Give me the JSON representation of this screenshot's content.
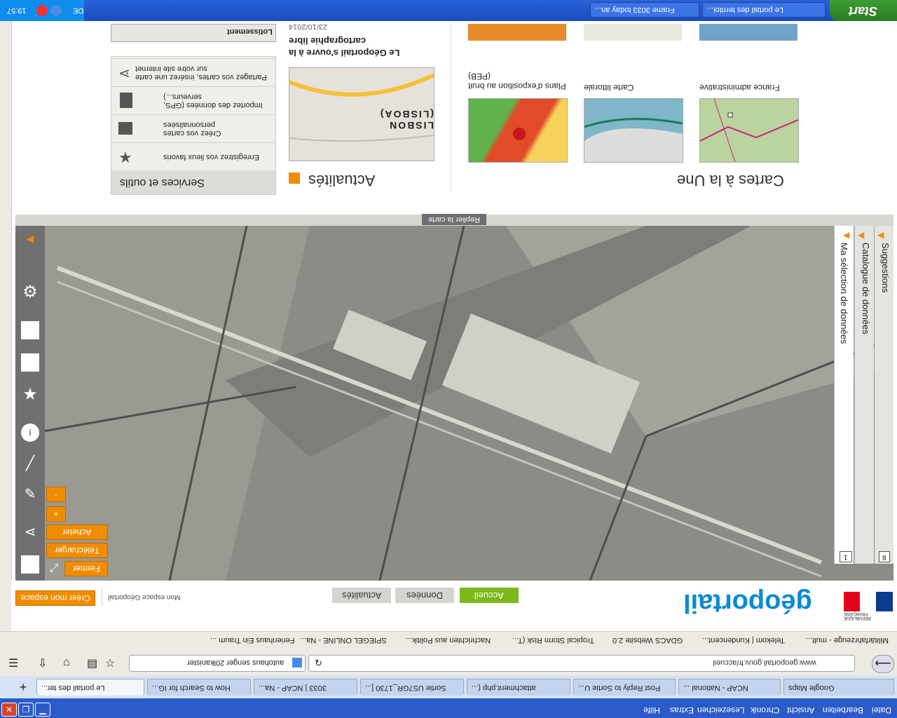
{
  "taskbar": {
    "start_label": "Start",
    "tasks": [
      {
        "label": "Le portail des territoi..."
      },
      {
        "label": "Frame 3033 today an..."
      }
    ],
    "tray": {
      "time": "19:57",
      "lang": "DE"
    }
  },
  "content": {
    "cartes_title": "Cartes à la Une",
    "cartes": [
      {
        "label": "France administrative"
      },
      {
        "label": "Carte littorale"
      },
      {
        "label": "Plans d'exposition au bruit (PEB)"
      }
    ],
    "actualites_title": "Actualités",
    "news_headline": "Le Géoportail s'ouvre à la cartographie libre",
    "news_date": "23/10/2014",
    "news_img_text": "LISBON (LISBOA)",
    "second_img_text": "Lotissement",
    "services_title": "Services et outils",
    "services": [
      {
        "label": "Enregistrez vos lieux favoris",
        "icon": "star-icon"
      },
      {
        "label": "Créez vos cartes personnalisées",
        "icon": "map-icon"
      },
      {
        "label": "Importez des données (GPS, serveurs...)",
        "icon": "import-icon"
      },
      {
        "label": "Partagez vos cartes, insérez une carte sur votre site internet",
        "icon": "share-icon"
      }
    ]
  },
  "map": {
    "replier_label": "Replier la carte",
    "panel_items": [
      {
        "label": "Suggestions"
      },
      {
        "label": "Catalogue de données"
      },
      {
        "label": "Ma sélection de données"
      }
    ],
    "buttons": {
      "fermer": "Fermer",
      "telecharger": "Télécharger",
      "acheter": "Acheter",
      "zoom_in": "+",
      "zoom_out": "-"
    },
    "counter_1": "1",
    "counter_2": "8"
  },
  "header": {
    "logo_text": "géoportail",
    "republique": "RÉPUBLIQUE FRANÇAISE",
    "tabs": [
      {
        "label": "Accueil"
      },
      {
        "label": "Données"
      },
      {
        "label": "Actualités"
      }
    ],
    "mon_espace": "Mon espace Géoportail",
    "creer_espace": "Créer mon espace"
  },
  "bookmarks": [
    {
      "label": "Militärfahrzeuge - mult..."
    },
    {
      "label": "Telekom | Kundencent..."
    },
    {
      "label": "GDACS Website 2.0"
    },
    {
      "label": "Tropical Storm Risk (T..."
    },
    {
      "label": "Nachrichten aus Politik..."
    },
    {
      "label": "SPIEGEL ONLINE - Na..."
    },
    {
      "label": "Ferienhaus Ein Traum ..."
    }
  ],
  "addressbar": {
    "url": "www.geoportail.gouv.fr/accueil",
    "search": "autohaus senger 20lkanister"
  },
  "tabs": [
    {
      "label": "Google Maps"
    },
    {
      "label": "NCAP - National ..."
    },
    {
      "label": "Post Reply to Sortie U..."
    },
    {
      "label": "attachment.php (..."
    },
    {
      "label": "Sortie US7GR_1730 [..."
    },
    {
      "label": "3033 | NCAP - Na..."
    },
    {
      "label": "How to Search for IG..."
    },
    {
      "label": "Le portail des ter..."
    }
  ],
  "menubar": [
    "Datei",
    "Bearbeiten",
    "Ansicht",
    "Chronik",
    "Lesezeichen",
    "Extras",
    "Hilfe"
  ]
}
